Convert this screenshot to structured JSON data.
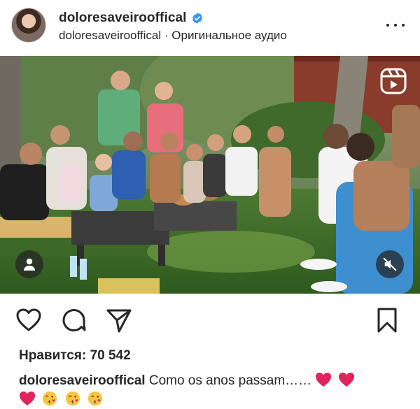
{
  "post": {
    "username": "doloresaveirooffical",
    "audio_line": "doloresaveirooffical · Оригинальное аудио",
    "likes_label": "Нравится:",
    "likes_count": "70 542",
    "caption_user": "doloresaveirooffical",
    "caption_text": "Como os anos passam……"
  },
  "icons": {
    "verified": "verified-badge-icon",
    "more": "more-options-icon",
    "reels": "reels-icon",
    "tag": "tagged-people-icon",
    "mute": "sound-off-icon",
    "like": "heart-icon",
    "comment": "comment-icon",
    "share": "send-icon",
    "save": "bookmark-icon",
    "caption_emojis": [
      "red-heart-emoji",
      "red-heart-emoji",
      "red-heart-emoji",
      "kissing-face-emoji",
      "kissing-face-emoji",
      "kissing-face-emoji"
    ]
  },
  "colors": {
    "verified_blue": "#3897f0",
    "text": "#262626",
    "heart_red": "#e0245e"
  }
}
